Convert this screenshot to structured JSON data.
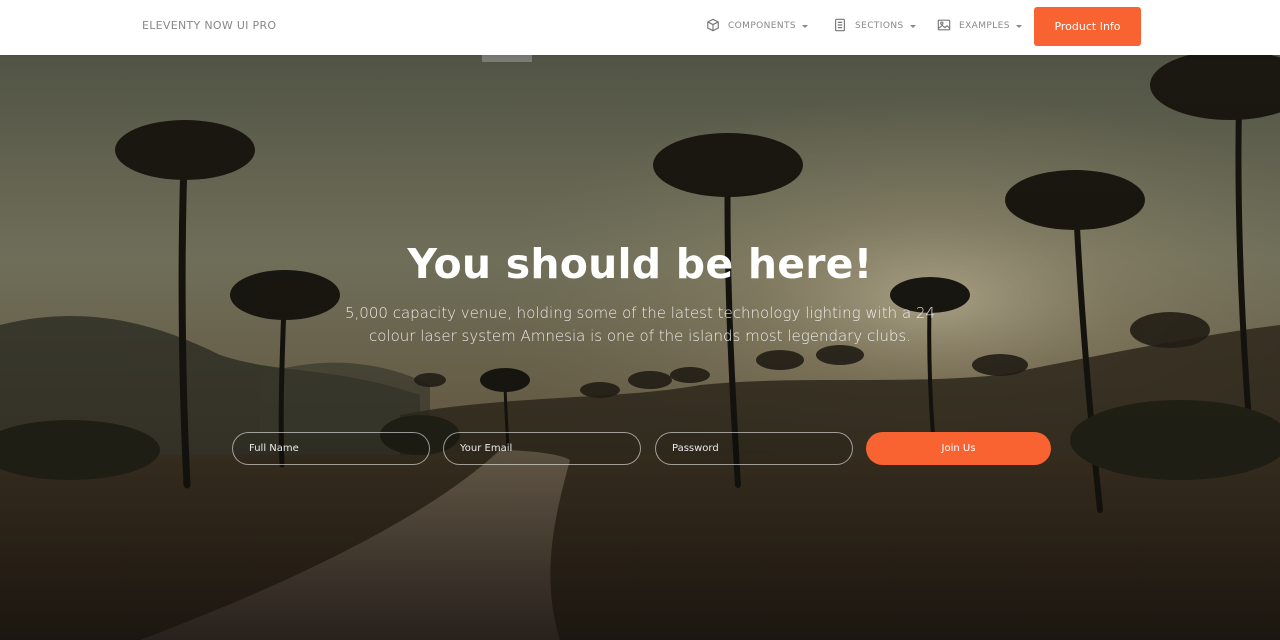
{
  "navbar": {
    "brand": "ELEVENTY NOW UI PRO",
    "items": [
      {
        "label": "COMPONENTS",
        "icon": "box-icon"
      },
      {
        "label": "SECTIONS",
        "icon": "document-icon"
      },
      {
        "label": "EXAMPLES",
        "icon": "image-icon"
      }
    ],
    "cta_label": "Product Info"
  },
  "hero": {
    "title": "You should be here!",
    "description": "5,000 capacity venue, holding some of the latest technology lighting with a 24 colour laser system Amnesia is one of the islands most legendary clubs.",
    "form": {
      "name_placeholder": "Full Name",
      "email_placeholder": "Your Email",
      "password_placeholder": "Password",
      "submit_label": "Join Us"
    }
  },
  "colors": {
    "accent": "#f96332",
    "navbar_bg": "#ffffff",
    "nav_text": "#888888"
  }
}
